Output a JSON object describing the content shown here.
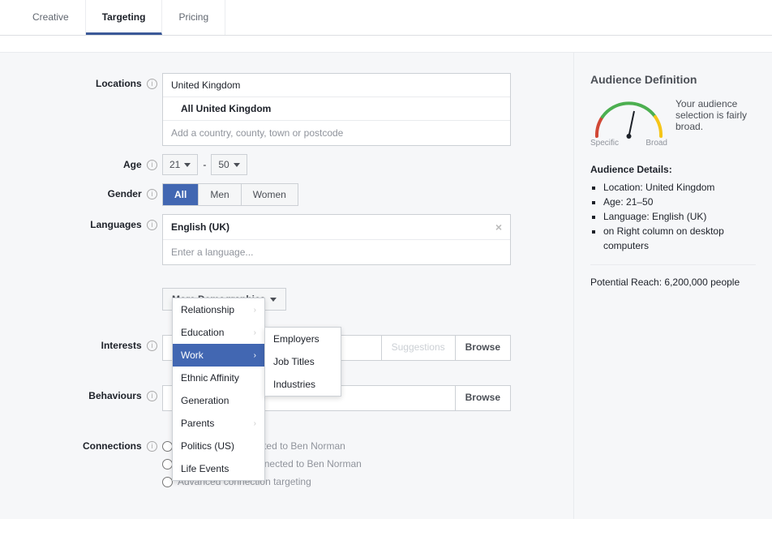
{
  "tabs": {
    "creative": "Creative",
    "targeting": "Targeting",
    "pricing": "Pricing"
  },
  "labels": {
    "locations": "Locations",
    "age": "Age",
    "gender": "Gender",
    "languages": "Languages",
    "interests": "Interests",
    "behaviours": "Behaviours",
    "connections": "Connections"
  },
  "locations": {
    "country": "United Kingdom",
    "sub": "All United Kingdom",
    "placeholder": "Add a country, county, town or postcode"
  },
  "age": {
    "min": "21",
    "sep": "-",
    "max": "50"
  },
  "gender": {
    "all": "All",
    "men": "Men",
    "women": "Women"
  },
  "languages": {
    "selected": "English (UK)",
    "placeholder": "Enter a language..."
  },
  "more_demo_btn": "More Demographics",
  "demo_menu": {
    "relationship": "Relationship",
    "education": "Education",
    "work": "Work",
    "ethnic": "Ethnic Affinity",
    "generation": "Generation",
    "parents": "Parents",
    "politics": "Politics (US)",
    "life": "Life Events"
  },
  "work_submenu": {
    "employers": "Employers",
    "job_titles": "Job Titles",
    "industries": "Industries"
  },
  "interests": {
    "suggestions": "Suggestions",
    "browse": "Browse"
  },
  "behaviours": {
    "browse": "Browse"
  },
  "connections": {
    "opt1": "Only people connected to Ben Norman",
    "opt2": "Only people not connected to Ben Norman",
    "opt3": "Advanced connection targeting"
  },
  "audience": {
    "title": "Audience Definition",
    "summary": "Your audience selection is fairly broad.",
    "specific": "Specific",
    "broad": "Broad",
    "details_title": "Audience Details:",
    "d1": "Location: United Kingdom",
    "d2": "Age: 21–50",
    "d3": "Language: English (UK)",
    "d4": "on Right column on desktop computers",
    "reach": "Potential Reach: 6,200,000 people"
  }
}
